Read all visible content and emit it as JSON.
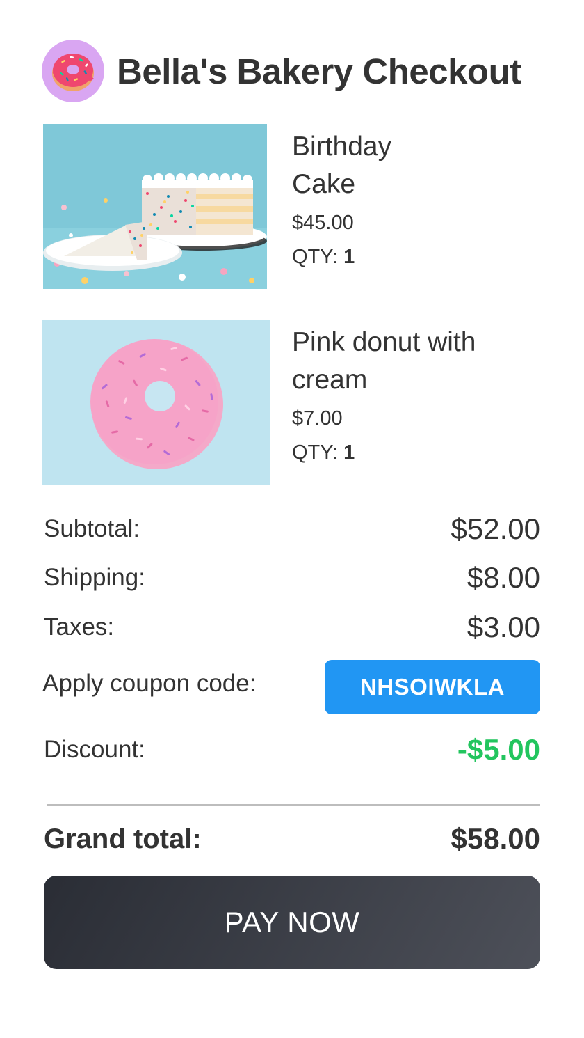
{
  "header": {
    "title": "Bella's Bakery Checkout",
    "logo_icon": "donut-icon"
  },
  "items": [
    {
      "name": "Birthday Cake",
      "price": "$45.00",
      "qty_label": "QTY:",
      "qty_value": "1",
      "image_icon": "cake-image"
    },
    {
      "name": "Pink donut with cream",
      "price": "$7.00",
      "qty_label": "QTY:",
      "qty_value": "1",
      "image_icon": "donut-image"
    }
  ],
  "summary": {
    "subtotal_label": "Subtotal:",
    "subtotal_value": "$52.00",
    "shipping_label": "Shipping:",
    "shipping_value": "$8.00",
    "taxes_label": "Taxes:",
    "taxes_value": "$3.00",
    "coupon_label": "Apply coupon code:",
    "coupon_code": "NHSOIWKLA",
    "discount_label": "Discount:",
    "discount_value": "-$5.00",
    "grand_total_label": "Grand total:",
    "grand_total_value": "$58.00"
  },
  "actions": {
    "pay_label": "PAY NOW"
  },
  "colors": {
    "accent": "#2196f3",
    "discount": "#22c55e",
    "pay_button": "#3a3d45",
    "logo_bg": "#d9a6f2"
  }
}
